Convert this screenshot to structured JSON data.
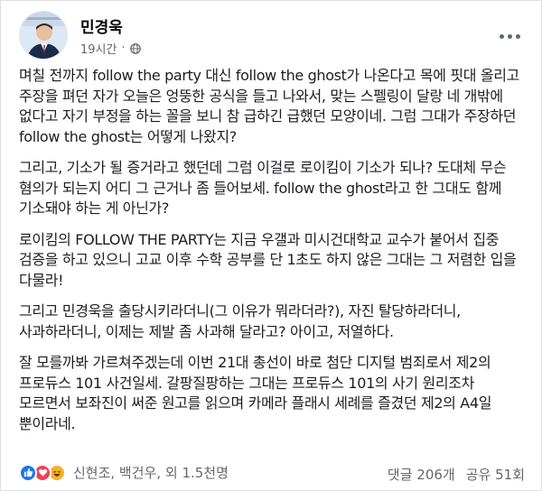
{
  "post": {
    "author": "민경욱",
    "time": "19시간",
    "audience_icon": "globe-icon",
    "paragraphs": [
      "며칠 전까지 follow the party 대신 follow the ghost가 나온다고 목에 핏대 올리고 주장을 펴던 자가 오늘은 엉뚱한 공식을 들고 나와서, 맞는 스펠링이 달랑 네 개밖에 없다고 자기 부정을 하는 꼴을 보니 참 급하긴 급했던 모양이네. 그럼 그대가 주장하던 follow the ghost는 어떻게 나왔지?",
      "그리고, 기소가 될 증거라고 했던데 그럼 이걸로 로이킴이 기소가 되나? 도대체 무슨 혐의가 되는지 어디 그 근거나 좀 들어보세. follow the ghost라고 한 그대도 함께 기소돼야 하는 게 아닌가?",
      "로이킴의 FOLLOW THE PARTY는 지금 우갤과 미시건대학교 교수가 붙어서 집중 검증을 하고 있으니 고교 이후 수학 공부를 단 1초도 하지 않은 그대는 그 저렴한 입을 다물라!",
      "그리고 민경욱을 출당시키라더니(그 이유가 뭐라더라?), 자진 탈당하라더니, 사과하라더니, 이제는 제발 좀 사과해 달라고? 아이고, 저열하다.",
      "잘 모를까봐 가르쳐주겠는데 이번 21대 총선이 바로 첨단 디지털 범죄로서 제2의 프로듀스 101 사건일세. 갈팡질팡하는 그대는 프로듀스 101의 사기 원리조차 모르면서 보좌진이 써준 원고를 읽으며 카메라 플래시 세례를 즐겼던 제2의 A4일 뿐이라네."
    ]
  },
  "footer": {
    "reaction_icons": [
      "like-icon",
      "love-icon",
      "haha-icon"
    ],
    "reaction_summary": "신현조, 백건우, 외 1.5천명",
    "comments": "댓글 206개",
    "shares": "공유 51회"
  },
  "colors": {
    "like": "#1877f2",
    "love": "#f33e58",
    "haha": "#f7b125",
    "meta": "#65676b"
  }
}
